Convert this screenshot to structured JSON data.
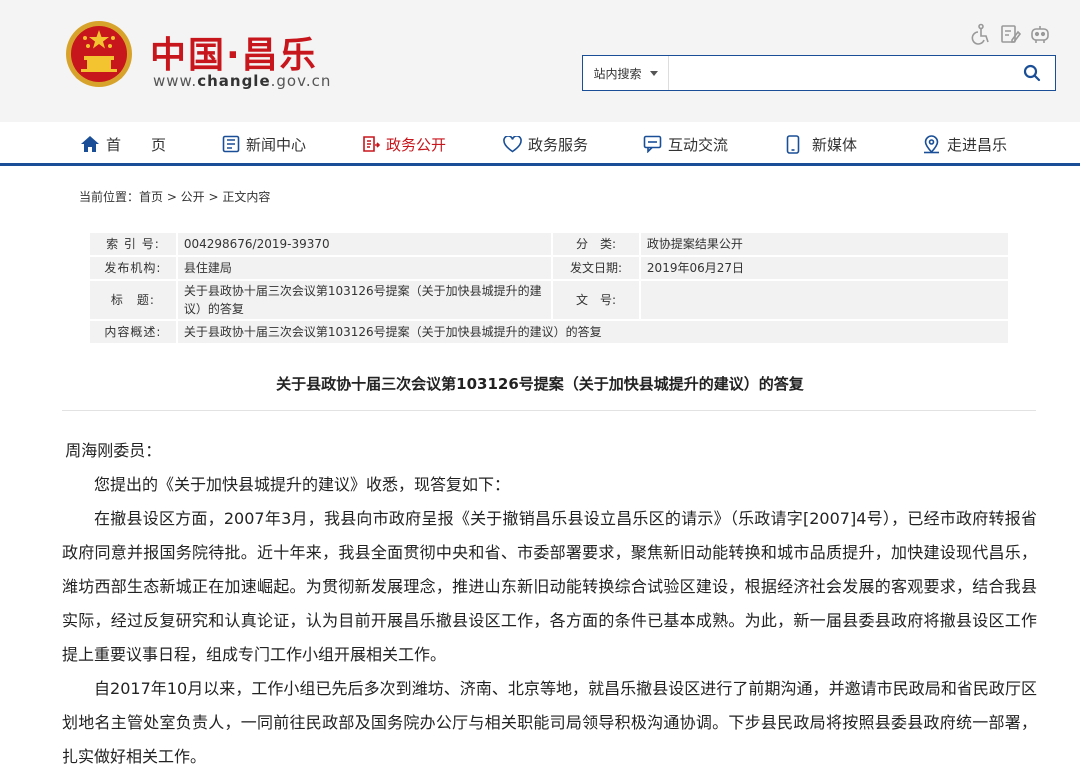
{
  "site": {
    "name": "中国·昌乐",
    "url_prefix": "www.",
    "url_domain": "changle",
    "url_suffix": ".gov.cn"
  },
  "tools": [
    "accessibility-icon",
    "edit-icon",
    "robot-icon"
  ],
  "search": {
    "scope": "站内搜索",
    "value": "",
    "placeholder": ""
  },
  "nav": {
    "items": [
      {
        "label": "首　　页",
        "icon": "home-icon"
      },
      {
        "label": "新闻中心",
        "icon": "news-icon"
      },
      {
        "label": "政务公开",
        "icon": "gov-open-icon"
      },
      {
        "label": "政务服务",
        "icon": "heart-icon"
      },
      {
        "label": "互动交流",
        "icon": "chat-icon"
      },
      {
        "label": "新媒体",
        "icon": "mobile-icon"
      },
      {
        "label": "走进昌乐",
        "icon": "location-icon"
      }
    ],
    "active_index": 2
  },
  "breadcrumb": "当前位置：首页 > 公开 > 正文内容",
  "meta": {
    "index_no_label": "索 引 号:",
    "index_no": "004298676/2019-39370",
    "category_label": "分　类:",
    "category": "政协提案结果公开",
    "publisher_label": "发布机构:",
    "publisher": "县住建局",
    "date_label": "发文日期:",
    "date": "2019年06月27日",
    "title_label": "标　题:",
    "title_line1": "关于县政协十届三次会议第103126号提案（关于加快县城提升的建",
    "title_line2": "议）的答复",
    "doc_no_label": "文　号:",
    "doc_no": "",
    "summary_label": "内容概述:",
    "summary": "关于县政协十届三次会议第103126号提案（关于加快县城提升的建议）的答复"
  },
  "doc_title": "关于县政协十届三次会议第103126号提案（关于加快县城提升的建议）的答复",
  "content": {
    "salutation": "周海刚委员：",
    "paragraphs": [
      "您提出的《关于加快县城提升的建议》收悉，现答复如下：",
      "在撤县设区方面，2007年3月，我县向市政府呈报《关于撤销昌乐县设立昌乐区的请示》（乐政请字[2007]4号），已经市政府转报省政府同意并报国务院待批。近十年来，我县全面贯彻中央和省、市委部署要求，聚焦新旧动能转换和城市品质提升，加快建设现代昌乐，潍坊西部生态新城正在加速崛起。为贯彻新发展理念，推进山东新旧动能转换综合试验区建设，根据经济社会发展的客观要求，结合我县实际，经过反复研究和认真论证，认为目前开展昌乐撤县设区工作，各方面的条件已基本成熟。为此，新一届县委县政府将撤县设区工作提上重要议事日程，组成专门工作小组开展相关工作。",
      "自2017年10月以来，工作小组已先后多次到潍坊、济南、北京等地，就昌乐撤县设区进行了前期沟通，并邀请市民政局和省民政厅区划地名主管处室负责人，一同前往民政部及国务院办公厅与相关职能司局领导积极沟通协调。下步县民政局将按照县委县政府统一部署，扎实做好相关工作。"
    ]
  },
  "colors": {
    "brand_red": "#c8161d",
    "nav_blue": "#1a4f97"
  }
}
